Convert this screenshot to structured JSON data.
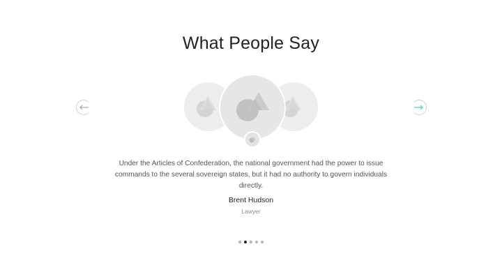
{
  "section": {
    "title": "What People Say"
  },
  "navigation": {
    "prev_icon": "arrow-left-icon",
    "next_icon": "arrow-right-icon",
    "accent_color": "#3dd6c4"
  },
  "avatars": [
    {
      "position": "left",
      "icon": "image-placeholder-icon"
    },
    {
      "position": "center",
      "icon": "image-placeholder-icon"
    },
    {
      "position": "right",
      "icon": "image-placeholder-icon"
    }
  ],
  "testimonial": {
    "quote": "Under the Articles of Confederation, the national government had the power to issue commands to the several sovereign states, but it had no authority to govern individuals directly.",
    "author_name": "Brent Hudson",
    "author_role": "Lawyer"
  },
  "pagination": {
    "total": 5,
    "active_index": 1
  }
}
